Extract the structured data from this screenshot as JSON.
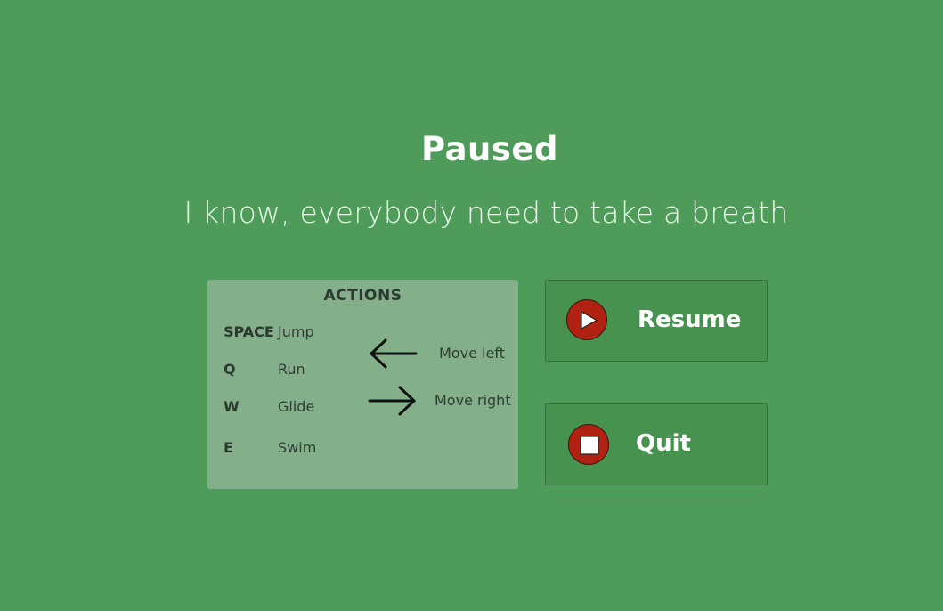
{
  "pause_menu": {
    "title": "Paused",
    "subtitle": "I know, everybody need to take a breath"
  },
  "actions": {
    "heading": "ACTIONS",
    "keys": [
      {
        "key": "SPACE",
        "action": "Jump"
      },
      {
        "key": "Q",
        "action": "Run"
      },
      {
        "key": "W",
        "action": "Glide"
      },
      {
        "key": "E",
        "action": "Swim"
      }
    ],
    "movement": [
      {
        "icon": "arrow-left-icon",
        "label": "Move left"
      },
      {
        "icon": "arrow-right-icon",
        "label": "Move right"
      }
    ]
  },
  "buttons": {
    "resume": {
      "label": "Resume",
      "icon": "play-icon"
    },
    "quit": {
      "label": "Quit",
      "icon": "stop-icon"
    }
  },
  "colors": {
    "background": "#4f9b59",
    "panel": "#83b08a",
    "button": "#48924f",
    "icon_circle": "#b12212"
  }
}
